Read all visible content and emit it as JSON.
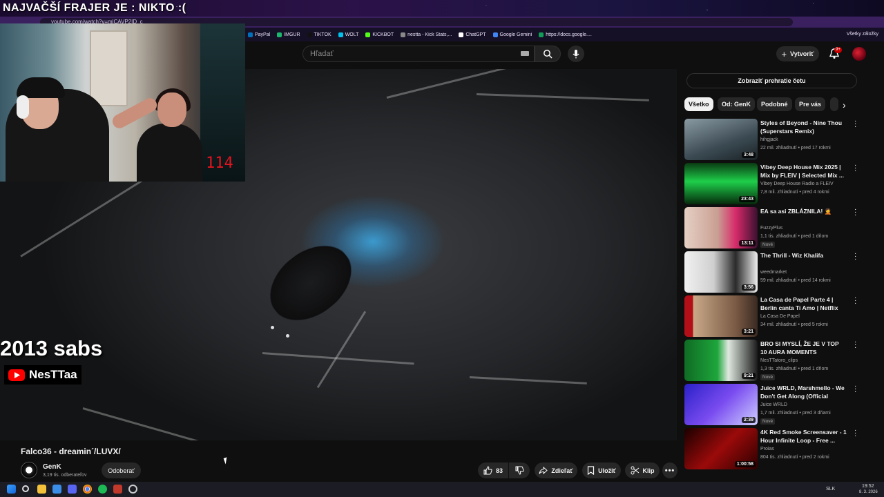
{
  "stream": {
    "overlay_title": "NAJVAČŠÍ FRAJER JE : NIKTO :(",
    "overlay_text": "2013 sabs",
    "youtube_tag": "NesTTaa",
    "webcam_counter": "114"
  },
  "browser": {
    "url": "youtube.com/watch?v=mlCAVP2ID_c",
    "bookmarks": [
      {
        "label": "PayPal",
        "color": "#0070ba"
      },
      {
        "label": "IMGUR",
        "color": "#1bb76e"
      },
      {
        "label": "TIKTOK",
        "color": "#111111"
      },
      {
        "label": "WOLT",
        "color": "#00c2e8"
      },
      {
        "label": "KICKBOT",
        "color": "#53fc18"
      },
      {
        "label": "nestta - Kick Stats,...",
        "color": "#888888"
      },
      {
        "label": "ChatGPT",
        "color": "#ffffff"
      },
      {
        "label": "Google Gemini",
        "color": "#4285f4"
      },
      {
        "label": "https://docs.google....",
        "color": "#0f9d58"
      }
    ],
    "all_bookmarks": "Všetky záložky"
  },
  "header": {
    "search_placeholder": "Hľadať",
    "create_label": "Vytvoriť",
    "notif_count": "9+"
  },
  "video": {
    "title": "Falco36 - dreamin´/LUVX/",
    "channel": "GenK",
    "subscribers": "3,19 tis. odberateľov",
    "subscribe_label": "Odoberať",
    "likes": "83",
    "share_label": "Zdieľať",
    "save_label": "Uložiť",
    "clip_label": "Klip"
  },
  "sidebar": {
    "chat_button": "Zobraziť prehratie četu",
    "chips": [
      "Všetko",
      "Od: GenK",
      "Podobné",
      "Pre vás"
    ],
    "recommendations": [
      {
        "title": "Styles of Beyond - Nine Thou (Superstars Remix)",
        "channel": "hihgjack",
        "meta": "22 mil. zhliadnutí • pred 17 rokmi",
        "duration": "3:48",
        "new": ""
      },
      {
        "title": "Vibey Deep House Mix 2025 | Mix by FLEIV | Selected Mix ...",
        "channel": "Vibey Deep House Radio a FLEIV",
        "meta": "7,8 mil. zhliadnutí • pred 4 rokmi",
        "duration": "23:43",
        "new": ""
      },
      {
        "title": "EA sa asi ZBLÁZNILA! 🤦",
        "channel": "FuzzyPlus",
        "meta": "1,1 tis. zhliadnutí • pred 1 dňom",
        "duration": "13:11",
        "new": "Nové"
      },
      {
        "title": "The Thrill - Wiz Khalifa",
        "channel": "weedmarket",
        "meta": "59 mil. zhliadnutí • pred 14 rokmi",
        "duration": "3:56",
        "new": ""
      },
      {
        "title": "La Casa de Papel Parte 4 | Berlin canta Ti Amo | Netflix",
        "channel": "La Casa De Papel",
        "meta": "34 mil. zhliadnutí • pred 5 rokmi",
        "duration": "3:21",
        "new": ""
      },
      {
        "title": "BRO SI MYSLÍ, ŽE JE V TOP 10 AURA MOMENTS",
        "channel": "NesTTatoro_clips",
        "meta": "1,3 tis. zhliadnutí • pred 1 dňom",
        "duration": "9:21",
        "new": "Nové"
      },
      {
        "title": "Juice WRLD, Marshmello - We Don't Get Along (Official Video)",
        "channel": "Juice WRLD",
        "meta": "1,7 mil. zhliadnutí • pred 3 dňami",
        "duration": "2:39",
        "new": "Nové"
      },
      {
        "title": "4K Red Smoke Screensaver - 1 Hour Infinite Loop - Free ...",
        "channel": "Proias",
        "meta": "804 tis. zhliadnutí • pred 2 rokmi",
        "duration": "1:00:58",
        "new": ""
      }
    ]
  },
  "taskbar": {
    "lang": "SLK",
    "time": "19:52",
    "date": "8. 3. 2026"
  }
}
